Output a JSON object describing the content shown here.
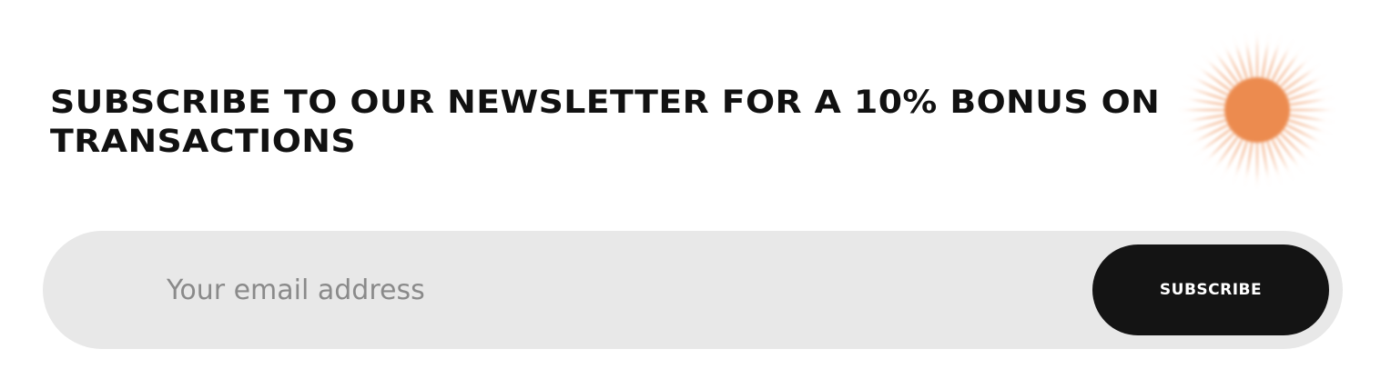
{
  "newsletter": {
    "heading": "SUBSCRIBE TO OUR NEWSLETTER FOR A 10% BONUS ON TRANSACTIONS",
    "email_placeholder": "Your email address",
    "subscribe_label": "SUBSCRIBE"
  },
  "colors": {
    "accent": "#ec8b4f",
    "button": "#141414",
    "field_background": "#e8e8e8",
    "text": "#111111"
  },
  "icons": {
    "decoration": "sun-burst-icon"
  }
}
